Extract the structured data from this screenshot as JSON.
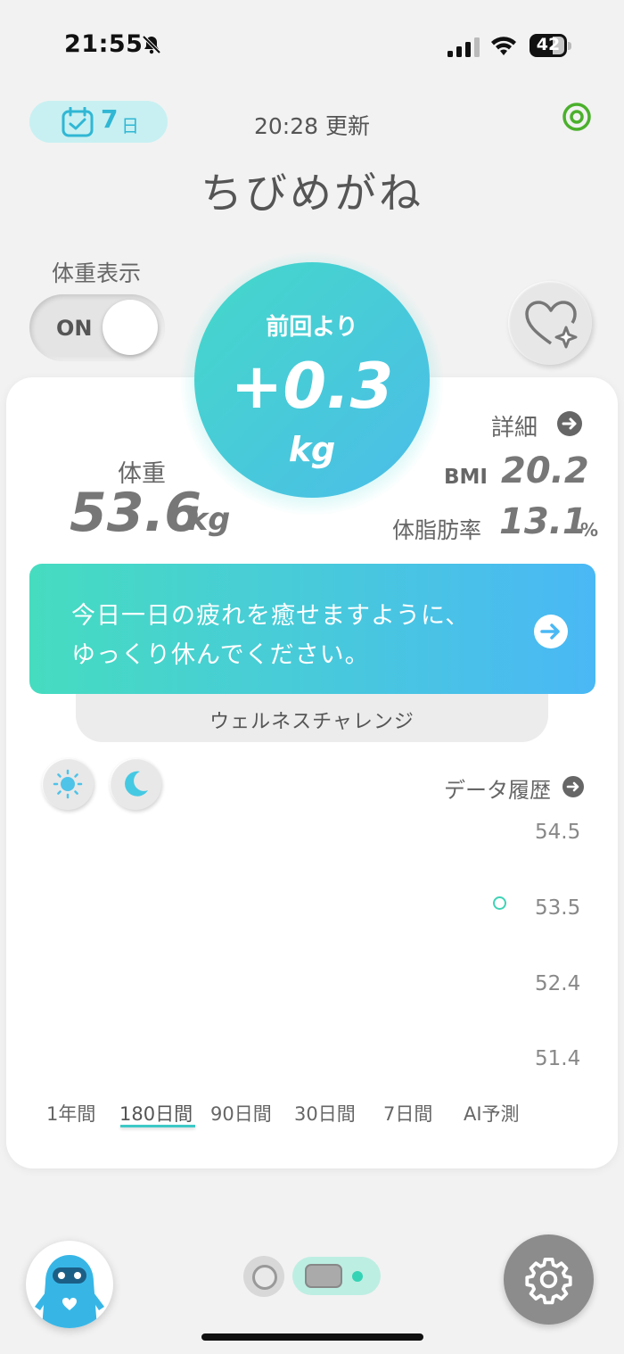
{
  "status_bar": {
    "time": "21:55",
    "battery": "42"
  },
  "header": {
    "streak_days": "7",
    "streak_unit": "日",
    "updated": "20:28 更新",
    "title": "ちびめがね"
  },
  "weight_toggle": {
    "label": "体重表示",
    "state": "ON"
  },
  "diff_bubble": {
    "label": "前回より",
    "value": "+0.3",
    "unit": "kg"
  },
  "weight": {
    "label": "体重",
    "value": "53.6",
    "unit": "kg"
  },
  "details": {
    "link": "詳細",
    "bmi_label": "BMI",
    "bmi_value": "20.2",
    "fat_label": "体脂肪率",
    "fat_value": "13.1",
    "fat_unit": "%"
  },
  "banner": {
    "line1": "今日一日の疲れを癒せますように、",
    "line2": "ゆっくり休んでください。",
    "tab": "ウェルネスチャレンジ"
  },
  "chart": {
    "history_link": "データ履歴",
    "ranges": [
      "1年間",
      "180日間",
      "90日間",
      "30日間",
      "7日間",
      "AI予測"
    ],
    "active_range": "180日間"
  },
  "chart_data": {
    "type": "scatter",
    "y_ticks": [
      "54.5",
      "53.5",
      "52.4",
      "51.4"
    ],
    "ylim": [
      51.4,
      54.5
    ],
    "series": [
      {
        "values": [
          53.6
        ]
      }
    ]
  },
  "colors": {
    "accent": "#45d8c9",
    "accent2": "#4bbde9",
    "point": "#3fd2b6"
  }
}
